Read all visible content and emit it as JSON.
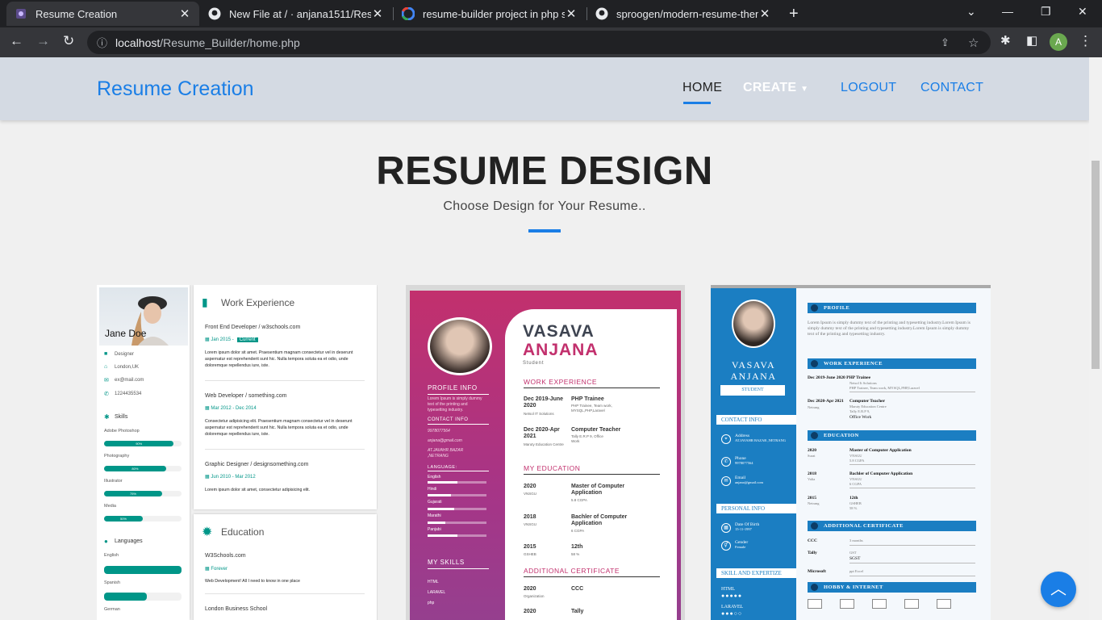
{
  "browser": {
    "tabs": [
      {
        "title": "Resume Creation",
        "active": true
      },
      {
        "title": "New File at / · anjana1511/Resum",
        "active": false
      },
      {
        "title": "resume-builder project in php so",
        "active": false
      },
      {
        "title": "sproogen/modern-resume-theme",
        "active": false
      }
    ],
    "url_host": "localhost",
    "url_path": "/Resume_Builder/home.php",
    "profile_initial": "A"
  },
  "nav": {
    "brand": "Resume Creation",
    "home": "HOME",
    "create": "CREATE",
    "logout": "LOGOUT",
    "contact": "CONTACT"
  },
  "hero": {
    "title": "RESUME DESIGN",
    "subtitle": "Choose Design for Your Resume.."
  },
  "template1": {
    "name": "Jane Doe",
    "info": [
      "Designer",
      "London,UK",
      "ex@mail.com",
      "1224435534"
    ],
    "skills_heading": "Skills",
    "skills": [
      {
        "name": "Adobe Photoshop",
        "value": 90,
        "label": "90%"
      },
      {
        "name": "Photography",
        "value": 80,
        "label": "80%"
      },
      {
        "name": "Illustrator",
        "value": 75,
        "label": "75%"
      },
      {
        "name": "Media",
        "value": 50,
        "label": "50%"
      }
    ],
    "languages_heading": "Languages",
    "languages": [
      {
        "name": "English",
        "value": 100
      },
      {
        "name": "Spanish",
        "value": 55
      },
      {
        "name": "German",
        "value": 0
      }
    ],
    "work_heading": "Work Experience",
    "jobs": [
      {
        "title": "Front End Developer / w3schools.com",
        "date": "Jan 2015 -",
        "tag": "Current",
        "desc": "Lorem ipsum dolor sit amet. Praesentium magnam consectetur vel in deserunt aspernatur est reprehenderit sunt hic. Nulla tempora soluta ea et odio, unde doloremque repellendus iure, iste."
      },
      {
        "title": "Web Developer / something.com",
        "date": "Mar 2012 - Dec 2014",
        "tag": "",
        "desc": "Consectetur adipisicing elit. Praesentium magnam consectetur vel in deserunt aspernatur est reprehenderit sunt hic. Nulla tempora soluta ea et odio, unde doloremque repellendus iure, iste."
      },
      {
        "title": "Graphic Designer / designsomething.com",
        "date": "Jun 2010 - Mar 2012",
        "tag": "",
        "desc": "Lorem ipsum dolor sit amet, consectetur adipisicing elit."
      }
    ],
    "education_heading": "Education",
    "education": [
      {
        "school": "W3Schools.com",
        "date": "Forever",
        "desc": "Web Development! All I need to know in one place"
      },
      {
        "school": "London Business School"
      }
    ]
  },
  "template2": {
    "first_name": "VASAVA",
    "last_name": "ANJANA",
    "role": "Student",
    "profile_heading": "PROFILE INFO",
    "profile_text": "Lorem Ipsum is simply dummy text of the printing and typesetting industry.",
    "contact_heading": "CONTACT INFO",
    "phone": "9978077564",
    "email": "anjana@gmail.com",
    "address": "AT.JAVAHR BAZAR ,NETRANG",
    "language_heading": "LANGUAGE:",
    "languages": [
      {
        "name": "English",
        "value": 50
      },
      {
        "name": "Hindi",
        "value": 40
      },
      {
        "name": "Gujarati",
        "value": 45
      },
      {
        "name": "Marathi",
        "value": 30
      },
      {
        "name": "Panjabi",
        "value": 50
      }
    ],
    "skills_heading": "MY SKILLS",
    "skills": [
      "HTML",
      "LARAVEL",
      "php"
    ],
    "work_heading": "WORK EXPERIENCE",
    "work": [
      {
        "years": "Dec 2019-June 2020",
        "org": "Netsol IT Solutions",
        "title": "PHP Trainee",
        "desc": "PHP Trainee, Team work, MYSQL,PHP,Laravel"
      },
      {
        "years": "Dec 2020-Apr 2021",
        "org": "Maruty Education Centre",
        "title": "Computer Teacher",
        "desc": "Tally E.R.P 9, Office Work"
      }
    ],
    "education_heading": "MY EDUCATION",
    "education": [
      {
        "year": "2020",
        "org": "VNSGU",
        "title": "Master of Computer Application",
        "detail": "5.8 CGPA"
      },
      {
        "year": "2018",
        "org": "VNSGU",
        "title": "Bachler of Computer Application",
        "detail": "6 CGPA"
      },
      {
        "year": "2015",
        "org": "GSHEB",
        "title": "12th",
        "detail": "58 %"
      }
    ],
    "cert_heading": "ADDITIONAL CERTIFICATE",
    "certs": [
      {
        "year": "2020",
        "org": "Organization",
        "title": "CCC"
      },
      {
        "year": "2020",
        "org": "",
        "title": "Tally"
      }
    ]
  },
  "template3": {
    "first_name": "VASAVA",
    "last_name": "ANJANA",
    "role": "STUDENT",
    "contact_heading": "CONTACT INFO",
    "contacts": [
      {
        "label": "Address",
        "value": "AT.JAVAHR BAZAR ,NETRANG"
      },
      {
        "label": "Phone",
        "value": "9978077564"
      },
      {
        "label": "Email",
        "value": "anjana@gmail.com"
      }
    ],
    "personal_heading": "PERSONAL INFO",
    "personal": [
      {
        "label": "Date Of Birth",
        "value": "15-11-1997"
      },
      {
        "label": "Gender",
        "value": "Female"
      }
    ],
    "skills_heading": "SKILL AND EXPERTIZE",
    "skills": [
      "HTML",
      "LARAVEL"
    ],
    "profile_heading": "PROFILE",
    "profile_text": "Lorem Ipsum is simply dummy text of the printing and typesetting industry.Lorem Ipsum is simply dummy text of the printing and typesetting industry.Lorem Ipsum is simply dummy text of the printing and typesetting industry.",
    "work_heading": "WORK EXPERIENCE",
    "work": [
      {
        "years": "Dec 2019-June 2020",
        "title": "PHP Trainee",
        "org": "Netsol It Solutions",
        "desc": "PHP Trainee, Team work, MYSQL,PHP,Laravel"
      },
      {
        "years": "Dec 2020-Apr 2021",
        "place": "Netrang",
        "title": "Computer Teacher",
        "org": "Maruty Education Centre",
        "desc": "Tally E.R.P 9,",
        "desc2": "Office Work"
      }
    ],
    "education_heading": "EDUCATION",
    "education": [
      {
        "year": "2020",
        "place": "Surat",
        "title": "Master of Computer Application",
        "org": "VNSGU",
        "detail": "5.8 CGPA"
      },
      {
        "year": "2018",
        "place": "Valia",
        "title": "Bachler of Computer Application",
        "org": "VNSGU",
        "detail": "6 CGPA"
      },
      {
        "year": "2015",
        "place": "Netrang",
        "title": "12th",
        "org": "GSHEB",
        "detail": "58 %"
      }
    ],
    "cert_heading": "ADDITIONAL CERTIFICATE",
    "certs": [
      {
        "name": "CCC",
        "title": "",
        "detail": "3 months"
      },
      {
        "name": "Tally",
        "title": "SGST",
        "detail": "GST"
      },
      {
        "name": "Microsoft",
        "title": "",
        "detail": "ppt Excel"
      }
    ],
    "hobby_heading": "HOBBY & INTERNET"
  }
}
